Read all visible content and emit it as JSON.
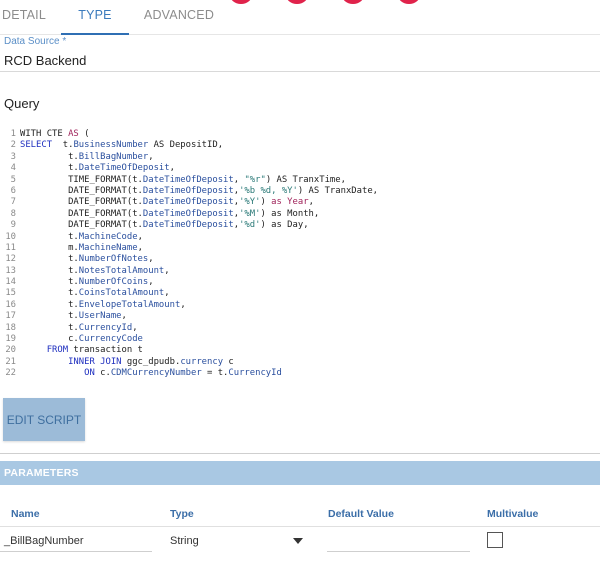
{
  "tabs": [
    {
      "label": "DETAIL",
      "active": false
    },
    {
      "label": "TYPE",
      "active": true
    },
    {
      "label": "ADVANCED",
      "active": false
    }
  ],
  "data_source": {
    "label": "Data Source",
    "required_marker": "*",
    "value": "RCD Backend"
  },
  "query": {
    "title": "Query",
    "lines": [
      {
        "n": "1",
        "parts": [
          {
            "t": "WITH CTE ",
            "c": ""
          },
          {
            "t": "AS",
            "c": "kw"
          },
          {
            "t": " (",
            "c": ""
          }
        ]
      },
      {
        "n": "2",
        "parts": [
          {
            "t": "SELECT",
            "c": "kwb"
          },
          {
            "t": "  t.",
            "c": ""
          },
          {
            "t": "BusinessNumber",
            "c": "fld"
          },
          {
            "t": " AS DepositID,",
            "c": ""
          }
        ]
      },
      {
        "n": "3",
        "parts": [
          {
            "t": "         t.",
            "c": ""
          },
          {
            "t": "BillBagNumber",
            "c": "fld"
          },
          {
            "t": ",",
            "c": ""
          }
        ]
      },
      {
        "n": "4",
        "parts": [
          {
            "t": "         t.",
            "c": ""
          },
          {
            "t": "DateTimeOfDeposit",
            "c": "fld"
          },
          {
            "t": ",",
            "c": ""
          }
        ]
      },
      {
        "n": "5",
        "parts": [
          {
            "t": "         TIME_FORMAT(t.",
            "c": ""
          },
          {
            "t": "DateTimeOfDeposit",
            "c": "fld"
          },
          {
            "t": ", ",
            "c": ""
          },
          {
            "t": "\"%r\"",
            "c": "str"
          },
          {
            "t": ") AS TranxTime,",
            "c": ""
          }
        ]
      },
      {
        "n": "6",
        "parts": [
          {
            "t": "         DATE_FORMAT(t.",
            "c": ""
          },
          {
            "t": "DateTimeOfDeposit",
            "c": "fld"
          },
          {
            "t": ",",
            "c": ""
          },
          {
            "t": "'%b %d, %Y'",
            "c": "str"
          },
          {
            "t": ") AS TranxDate,",
            "c": ""
          }
        ]
      },
      {
        "n": "7",
        "parts": [
          {
            "t": "         DATE_FORMAT(t.",
            "c": ""
          },
          {
            "t": "DateTimeOfDeposit",
            "c": "fld"
          },
          {
            "t": ",",
            "c": ""
          },
          {
            "t": "'%Y'",
            "c": "str"
          },
          {
            "t": ") ",
            "c": ""
          },
          {
            "t": "as Year",
            "c": "kw"
          },
          {
            "t": ",",
            "c": ""
          }
        ]
      },
      {
        "n": "8",
        "parts": [
          {
            "t": "         DATE_FORMAT(t.",
            "c": ""
          },
          {
            "t": "DateTimeOfDeposit",
            "c": "fld"
          },
          {
            "t": ",",
            "c": ""
          },
          {
            "t": "'%M'",
            "c": "str"
          },
          {
            "t": ") as Month,",
            "c": ""
          }
        ]
      },
      {
        "n": "9",
        "parts": [
          {
            "t": "         DATE_FORMAT(t.",
            "c": ""
          },
          {
            "t": "DateTimeOfDeposit",
            "c": "fld"
          },
          {
            "t": ",",
            "c": ""
          },
          {
            "t": "'%d'",
            "c": "str"
          },
          {
            "t": ") as Day,",
            "c": ""
          }
        ]
      },
      {
        "n": "10",
        "parts": [
          {
            "t": "         t.",
            "c": ""
          },
          {
            "t": "MachineCode",
            "c": "fld"
          },
          {
            "t": ",",
            "c": ""
          }
        ]
      },
      {
        "n": "11",
        "parts": [
          {
            "t": "         m.",
            "c": ""
          },
          {
            "t": "MachineName",
            "c": "fld"
          },
          {
            "t": ",",
            "c": ""
          }
        ]
      },
      {
        "n": "12",
        "parts": [
          {
            "t": "         t.",
            "c": ""
          },
          {
            "t": "NumberOfNotes",
            "c": "fld"
          },
          {
            "t": ",",
            "c": ""
          }
        ]
      },
      {
        "n": "13",
        "parts": [
          {
            "t": "         t.",
            "c": ""
          },
          {
            "t": "NotesTotalAmount",
            "c": "fld"
          },
          {
            "t": ",",
            "c": ""
          }
        ]
      },
      {
        "n": "14",
        "parts": [
          {
            "t": "         t.",
            "c": ""
          },
          {
            "t": "NumberOfCoins",
            "c": "fld"
          },
          {
            "t": ",",
            "c": ""
          }
        ]
      },
      {
        "n": "15",
        "parts": [
          {
            "t": "         t.",
            "c": ""
          },
          {
            "t": "CoinsTotalAmount",
            "c": "fld"
          },
          {
            "t": ",",
            "c": ""
          }
        ]
      },
      {
        "n": "16",
        "parts": [
          {
            "t": "         t.",
            "c": ""
          },
          {
            "t": "EnvelopeTotalAmount",
            "c": "fld"
          },
          {
            "t": ",",
            "c": ""
          }
        ]
      },
      {
        "n": "17",
        "parts": [
          {
            "t": "         t.",
            "c": ""
          },
          {
            "t": "UserName",
            "c": "fld"
          },
          {
            "t": ",",
            "c": ""
          }
        ]
      },
      {
        "n": "18",
        "parts": [
          {
            "t": "         t.",
            "c": ""
          },
          {
            "t": "CurrencyId",
            "c": "fld"
          },
          {
            "t": ",",
            "c": ""
          }
        ]
      },
      {
        "n": "19",
        "parts": [
          {
            "t": "         c.",
            "c": ""
          },
          {
            "t": "CurrencyCode",
            "c": "fld"
          }
        ]
      },
      {
        "n": "20",
        "parts": [
          {
            "t": "     ",
            "c": ""
          },
          {
            "t": "FROM",
            "c": "kwb"
          },
          {
            "t": " transaction t",
            "c": ""
          }
        ]
      },
      {
        "n": "21",
        "parts": [
          {
            "t": "         ",
            "c": ""
          },
          {
            "t": "INNER JOIN",
            "c": "kwb"
          },
          {
            "t": " ggc_dpudb.",
            "c": ""
          },
          {
            "t": "currency",
            "c": "fld"
          },
          {
            "t": " c",
            "c": ""
          }
        ]
      },
      {
        "n": "22",
        "parts": [
          {
            "t": "            ",
            "c": ""
          },
          {
            "t": "ON",
            "c": "kwb"
          },
          {
            "t": " c.",
            "c": ""
          },
          {
            "t": "CDMCurrencyNumber",
            "c": "fld"
          },
          {
            "t": " = t.",
            "c": ""
          },
          {
            "t": "CurrencyId",
            "c": "fld"
          }
        ]
      }
    ]
  },
  "edit_script_label": "EDIT SCRIPT",
  "parameters": {
    "title": "PARAMETERS",
    "columns": [
      "Name",
      "Type",
      "Default Value",
      "Multivalue"
    ],
    "rows": [
      {
        "name": "_BillBagNumber",
        "type": "String",
        "default_value": "",
        "multivalue": false
      }
    ]
  },
  "colors": {
    "accent": "#2f6fb4",
    "parameters_bar": "#a9c8e3",
    "edit_button": "#9cbbd8",
    "decor_dot": "#e0234b"
  }
}
